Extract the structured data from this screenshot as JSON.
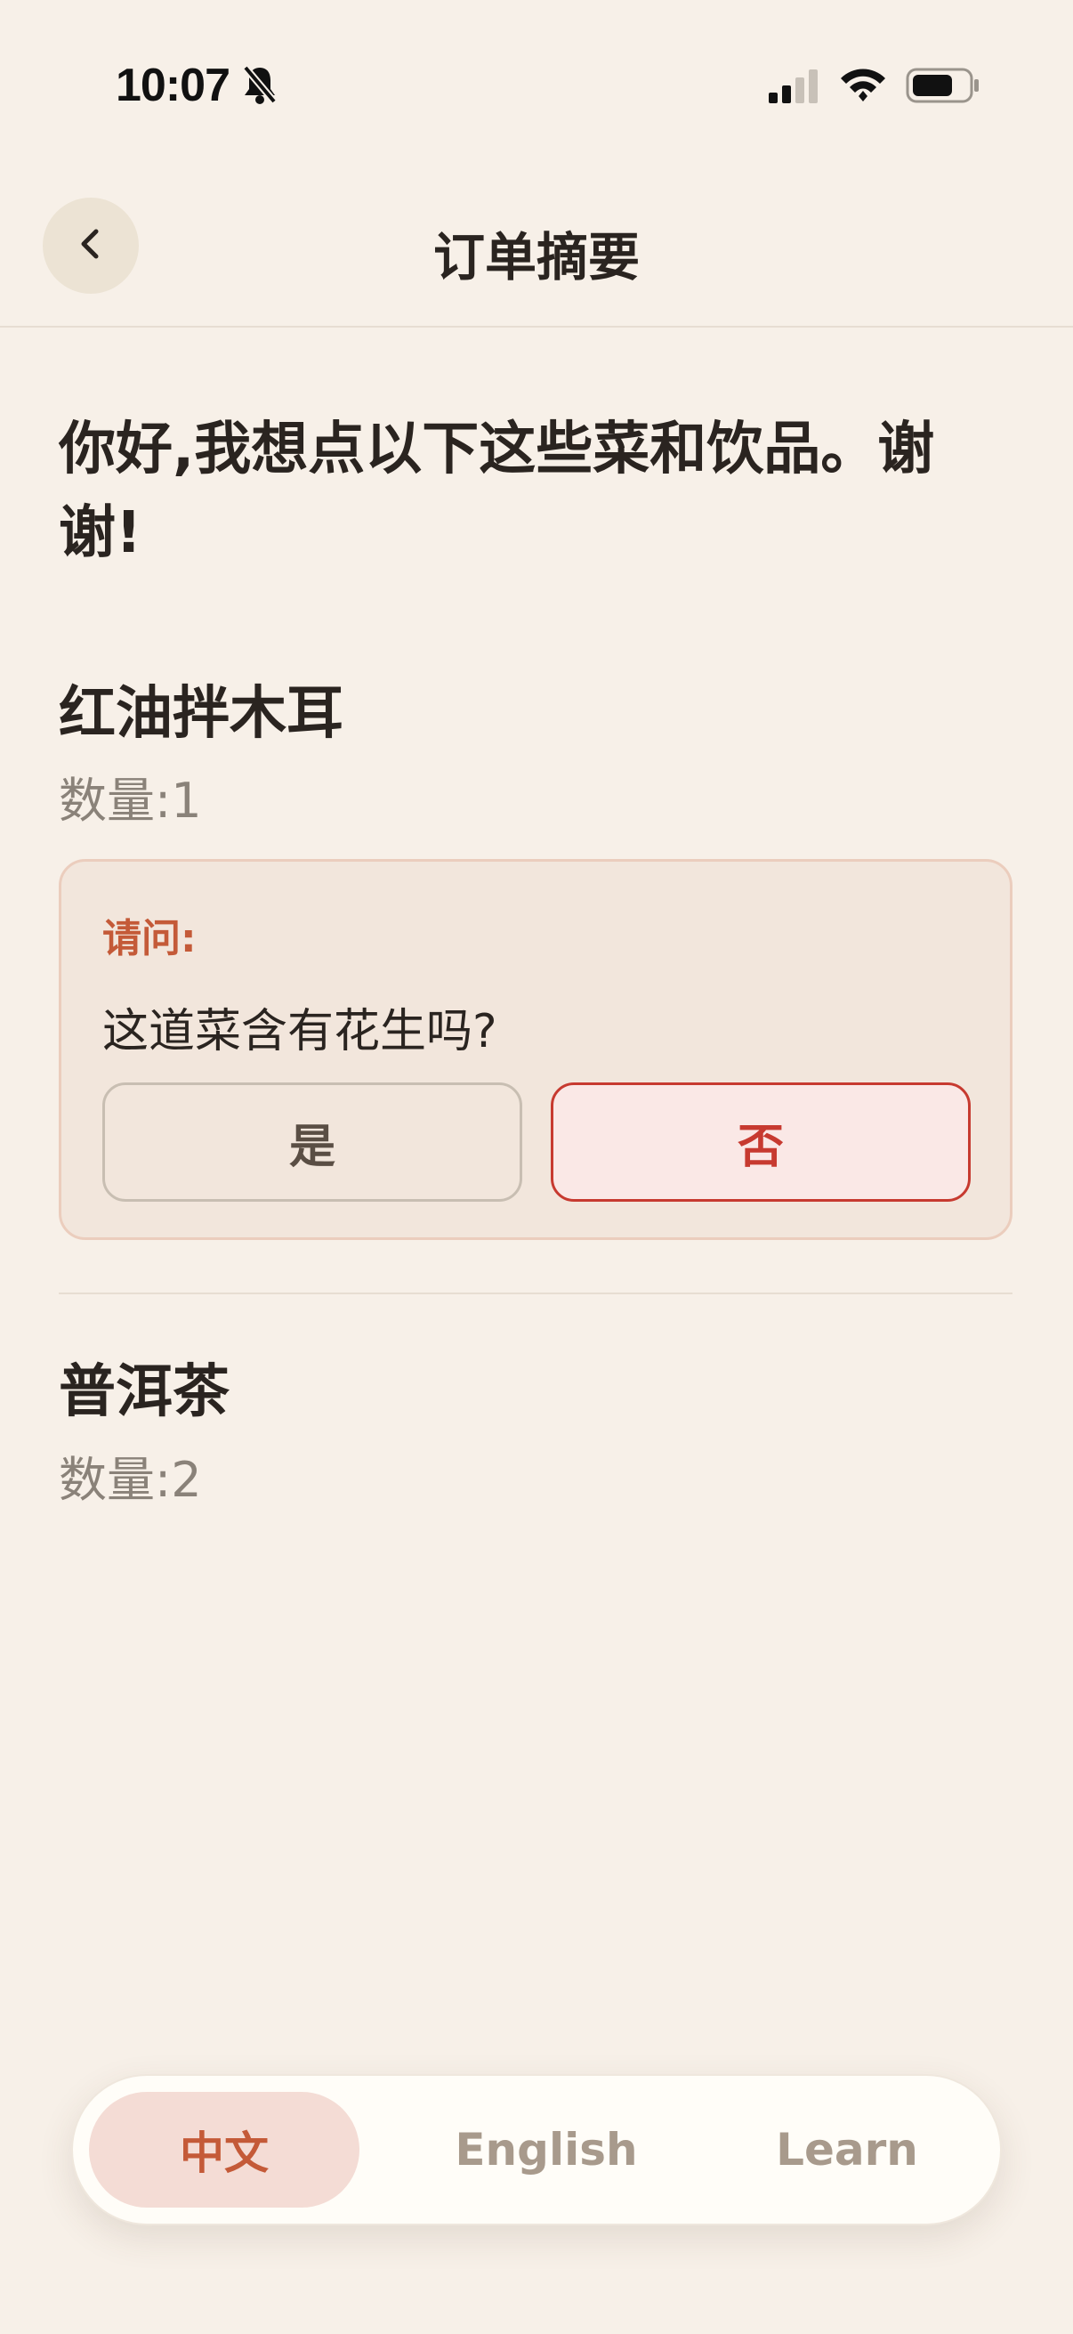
{
  "status_bar": {
    "time": "10:07"
  },
  "header": {
    "title": "订单摘要"
  },
  "intro": "你好,我想点以下这些菜和饮品。谢谢!",
  "items": [
    {
      "name": "红油拌木耳",
      "quantity": "数量:1"
    },
    {
      "name": "普洱茶",
      "quantity": "数量:2"
    }
  ],
  "question": {
    "label": "请问:",
    "text": "这道菜含有花生吗?",
    "yes": "是",
    "no": "否"
  },
  "tabs": {
    "chinese": "中文",
    "english": "English",
    "learn": "Learn"
  },
  "colors": {
    "accent": "#c45a38",
    "danger": "#c73a30",
    "background": "#f7f0e8"
  },
  "icons": [
    "bell-slash-icon",
    "cellular-signal-icon",
    "wifi-icon",
    "battery-icon",
    "chevron-left-icon"
  ]
}
